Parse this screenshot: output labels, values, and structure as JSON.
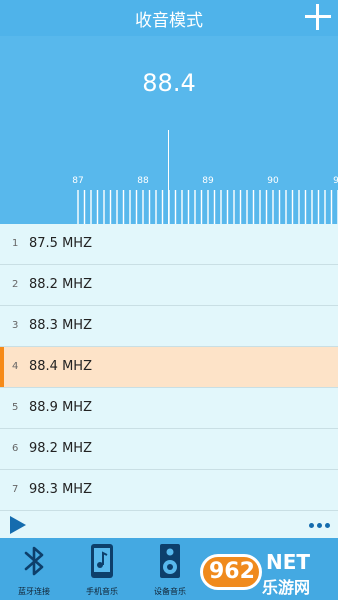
{
  "header": {
    "title": "收音模式"
  },
  "tuner": {
    "current_frequency": "88.4",
    "scale_labels": [
      "87",
      "88",
      "89",
      "90",
      "9"
    ]
  },
  "stations": [
    {
      "index": "1",
      "name": "87.5 MHZ"
    },
    {
      "index": "2",
      "name": "88.2 MHZ"
    },
    {
      "index": "3",
      "name": "88.3 MHZ"
    },
    {
      "index": "4",
      "name": "88.4 MHZ",
      "active": true
    },
    {
      "index": "5",
      "name": "88.9 MHZ"
    },
    {
      "index": "6",
      "name": "98.2 MHZ"
    },
    {
      "index": "7",
      "name": "98.3 MHZ"
    }
  ],
  "tabs": [
    {
      "label": "蓝牙连接",
      "icon": "bluetooth-icon"
    },
    {
      "label": "手机音乐",
      "icon": "phone-music-icon"
    },
    {
      "label": "设备音乐",
      "icon": "speaker-icon"
    }
  ],
  "watermark": {
    "number": "962",
    "net": "NET",
    "site": "乐游网"
  },
  "colors": {
    "header": "#4fb3ea",
    "accent": "#f68a17",
    "highlight": "#fde3c8",
    "icon": "#156cae"
  }
}
